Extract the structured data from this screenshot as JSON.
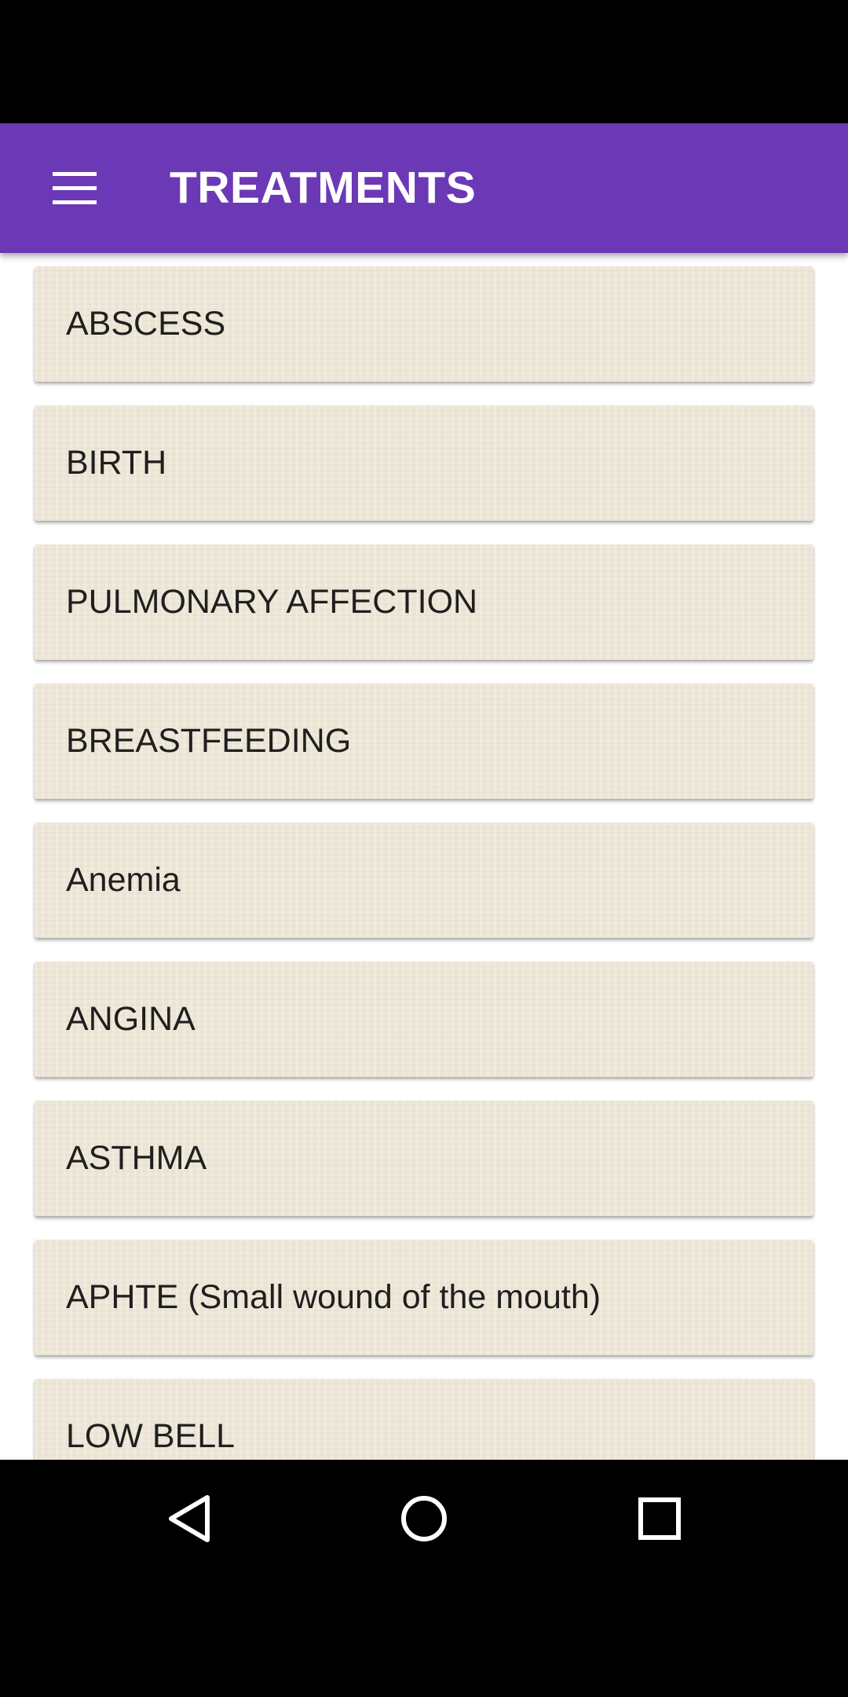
{
  "app_bar": {
    "title": "TREATMENTS",
    "menu_icon": "hamburger-menu-icon",
    "background_color": "#6b39b6"
  },
  "list": {
    "items": [
      {
        "label": "ABSCESS"
      },
      {
        "label": "BIRTH"
      },
      {
        "label": "PULMONARY AFFECTION"
      },
      {
        "label": "BREASTFEEDING"
      },
      {
        "label": "Anemia"
      },
      {
        "label": "ANGINA"
      },
      {
        "label": "ASTHMA"
      },
      {
        "label": "APHTE (Small wound of the mouth)"
      },
      {
        "label": "LOW BELL"
      }
    ],
    "card_color": "#efe8d8"
  },
  "nav_bar": {
    "back_icon": "back-triangle-icon",
    "home_icon": "home-circle-icon",
    "recents_icon": "recents-square-icon"
  }
}
